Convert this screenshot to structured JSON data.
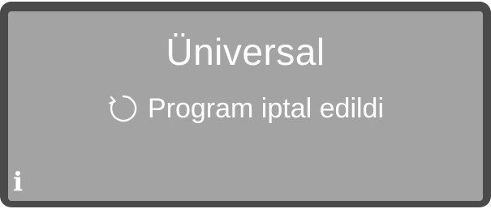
{
  "display": {
    "program_name": "Ünivers­al",
    "status_text": "Program iptal edildi",
    "status_icon": "restart-arrow-icon",
    "info_glyph": "i",
    "info_icon": "info-icon"
  },
  "colors": {
    "bezel": "#4a4a4a",
    "screen_background": "#a3a3a3",
    "text": "#ffffff"
  }
}
